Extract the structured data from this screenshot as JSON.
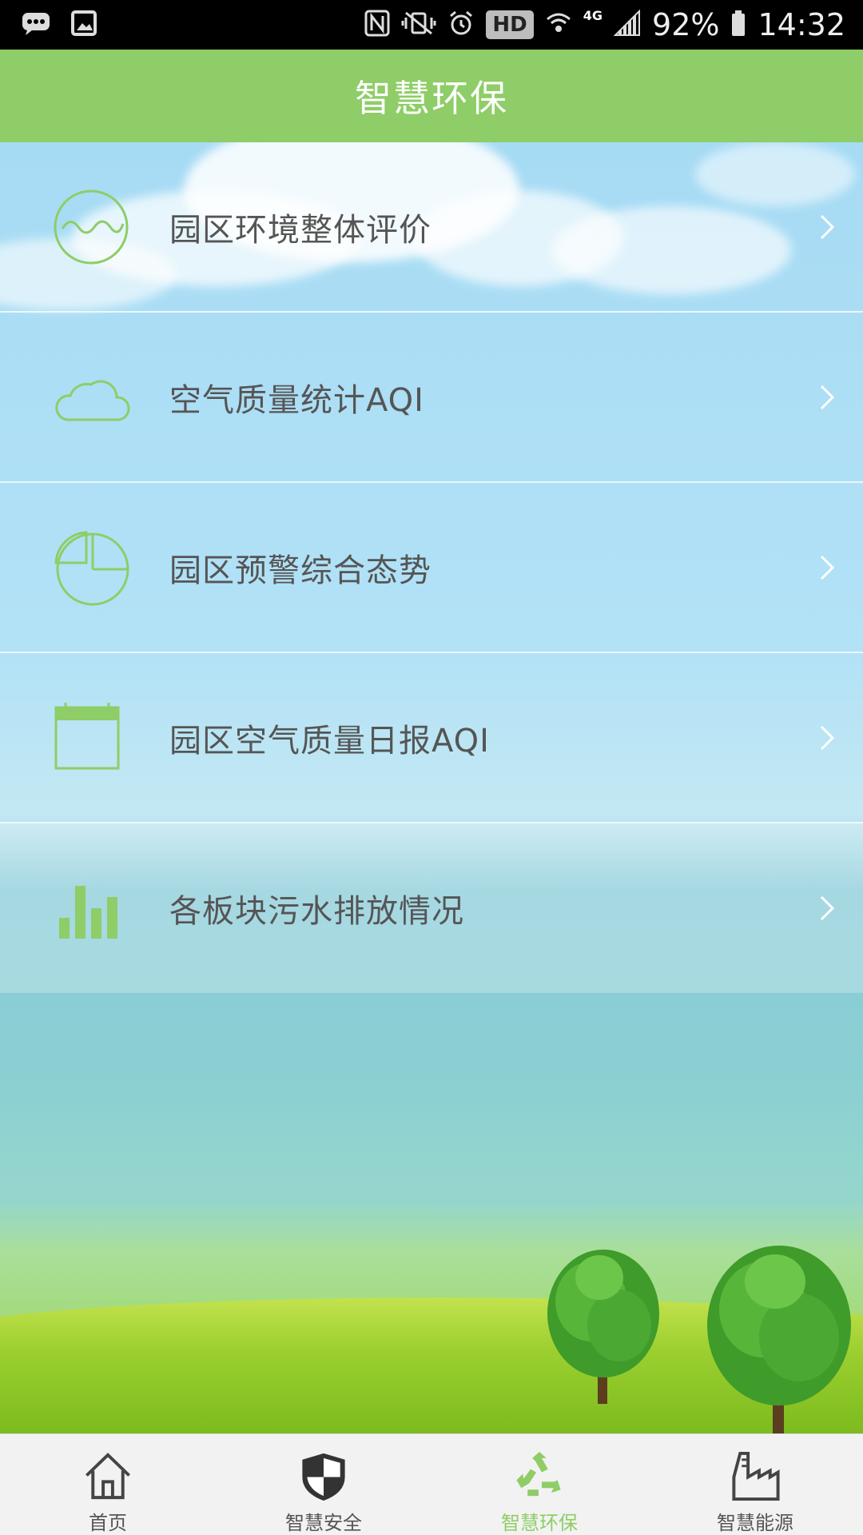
{
  "status_bar": {
    "network": "4G",
    "hd": "HD",
    "battery": "92%",
    "time": "14:32"
  },
  "header": {
    "title": "智慧环保"
  },
  "menu": {
    "items": [
      {
        "label": "园区环境整体评价",
        "icon": "wave-circle-icon"
      },
      {
        "label": "空气质量统计AQI",
        "icon": "cloud-icon"
      },
      {
        "label": "园区预警综合态势",
        "icon": "pie-chart-icon"
      },
      {
        "label": "园区空气质量日报AQI",
        "icon": "calendar-icon"
      },
      {
        "label": "各板块污水排放情况",
        "icon": "bar-chart-icon"
      }
    ]
  },
  "bottom_nav": {
    "items": [
      {
        "label": "首页",
        "icon": "home-icon",
        "active": false
      },
      {
        "label": "智慧安全",
        "icon": "shield-icon",
        "active": false
      },
      {
        "label": "智慧环保",
        "icon": "recycle-icon",
        "active": true
      },
      {
        "label": "智慧能源",
        "icon": "factory-icon",
        "active": false
      }
    ]
  },
  "colors": {
    "accent": "#8ecd67",
    "text": "#555555"
  }
}
